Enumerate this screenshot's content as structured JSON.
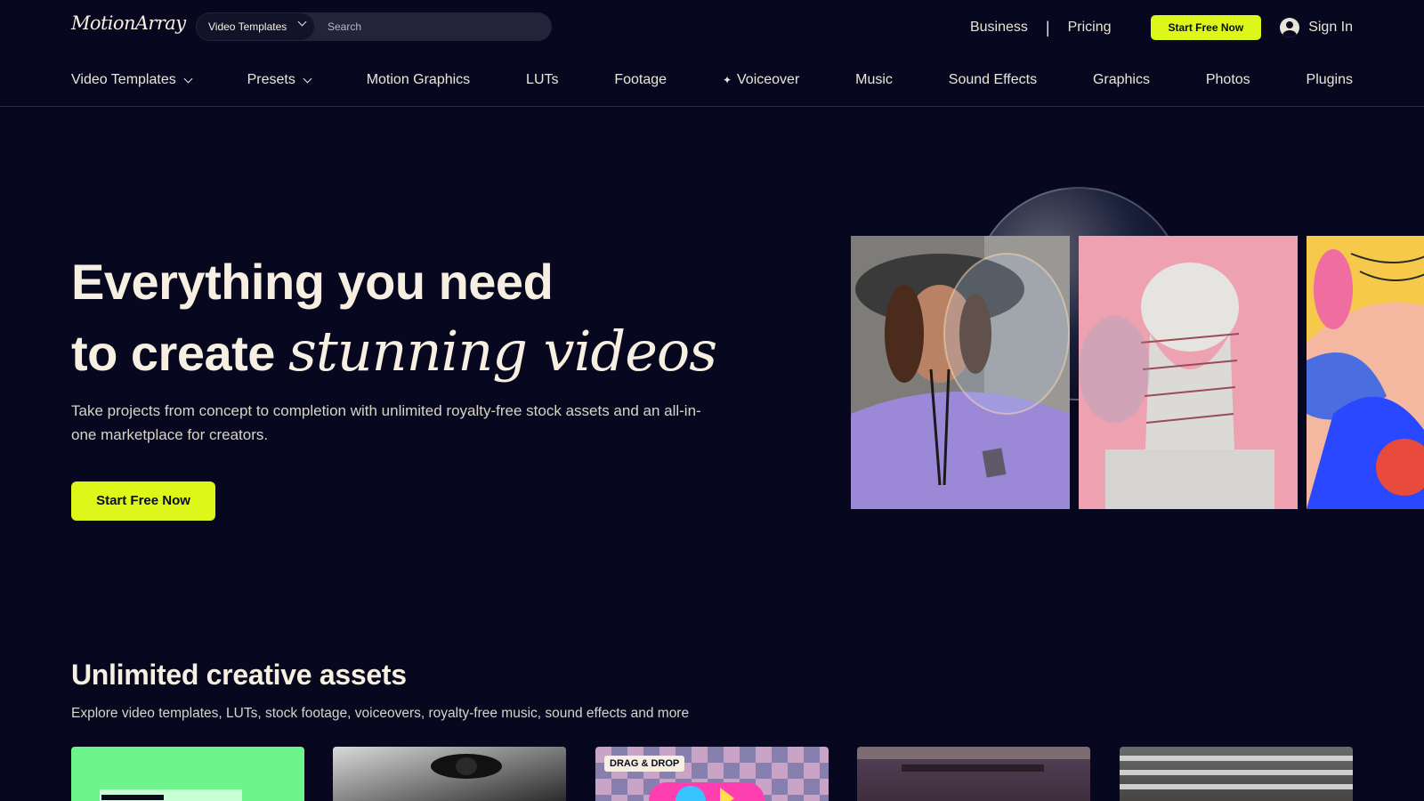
{
  "header": {
    "logo_text": "MotionArray",
    "search": {
      "category": "Video Templates",
      "placeholder": "Search"
    },
    "links": {
      "business": "Business",
      "separator": "|",
      "pricing": "Pricing"
    },
    "cta_label": "Start Free Now",
    "signin_label": "Sign In"
  },
  "nav": {
    "items": [
      {
        "label": "Video Templates",
        "has_dropdown": true
      },
      {
        "label": "Presets",
        "has_dropdown": true
      },
      {
        "label": "Motion Graphics"
      },
      {
        "label": "LUTs"
      },
      {
        "label": "Footage"
      },
      {
        "label": "Voiceover",
        "icon": "sparkle-icon"
      },
      {
        "label": "Music"
      },
      {
        "label": "Sound Effects"
      },
      {
        "label": "Graphics"
      },
      {
        "label": "Photos"
      },
      {
        "label": "Plugins"
      }
    ]
  },
  "hero": {
    "title_line1": "Everything you need",
    "title_line2_prefix": "to create",
    "title_line2_accent": "stunning videos",
    "subtitle": "Take projects from concept to completion with unlimited royalty-free stock assets and an all-in-one marketplace for creators.",
    "cta_label": "Start Free Now"
  },
  "assets_section": {
    "title": "Unlimited creative assets",
    "subtitle": "Explore video templates, LUTs, stock footage, voiceovers, royalty-free music, sound effects and more",
    "cards": [
      {
        "badge": ""
      },
      {
        "badge": ""
      },
      {
        "badge": "DRAG & DROP"
      },
      {
        "badge": ""
      },
      {
        "badge": ""
      }
    ]
  },
  "colors": {
    "background": "#07081f",
    "accent": "#dcf719",
    "text": "#f6efe2"
  }
}
